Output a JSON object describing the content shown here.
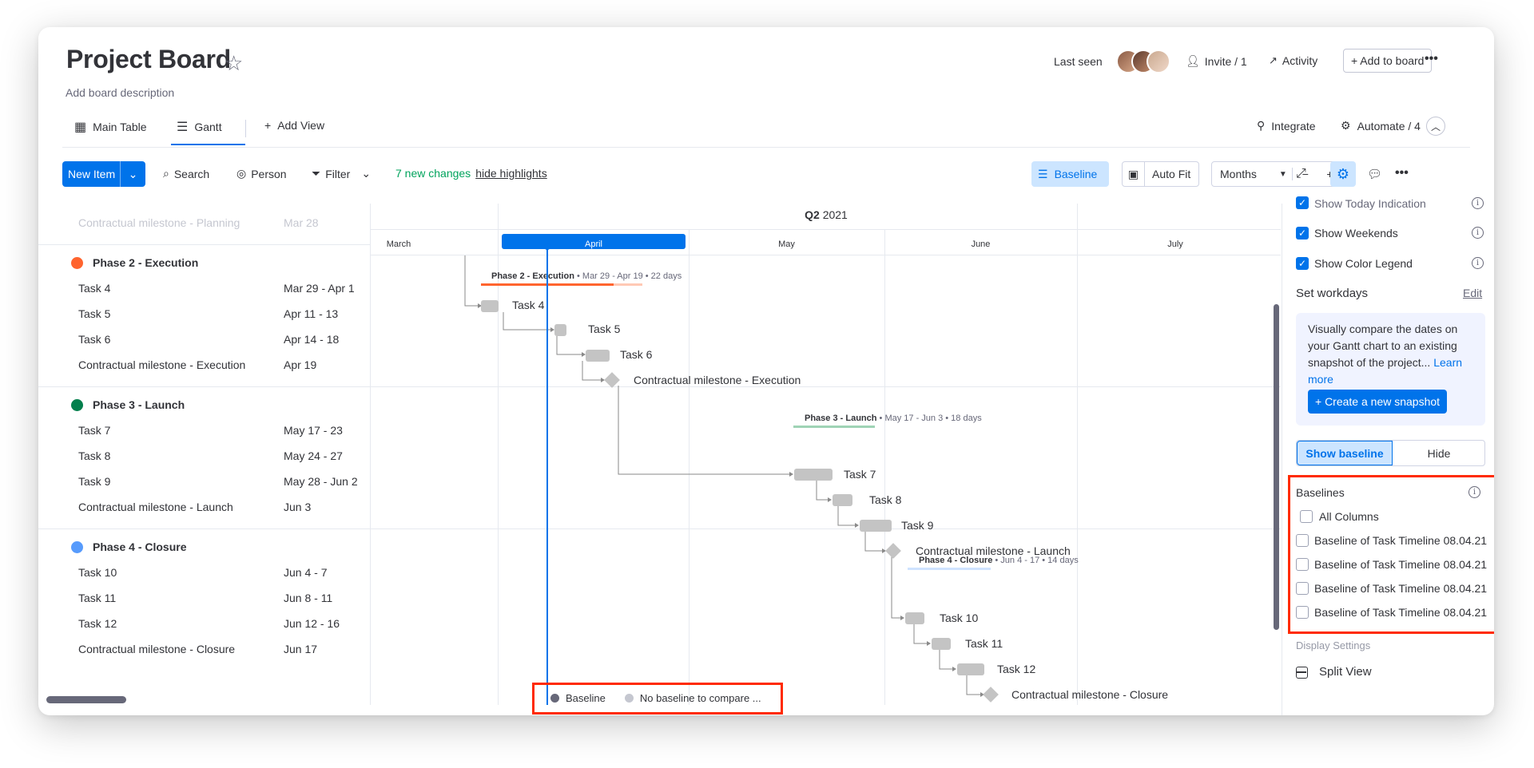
{
  "header": {
    "title": "Project Board",
    "description": "Add board description",
    "last_seen": "Last seen",
    "invite": "Invite / 1",
    "activity": "Activity",
    "add_to_board": "Add to board",
    "more": "•••"
  },
  "tabs": {
    "main_table": "Main Table",
    "gantt": "Gantt",
    "add_view": "Add View",
    "integrate": "Integrate",
    "automate": "Automate / 4"
  },
  "toolbar": {
    "new_item": "New Item",
    "search": "Search",
    "person": "Person",
    "filter": "Filter",
    "changes": "7 new changes",
    "hide_highlights": "hide highlights",
    "baseline": "Baseline",
    "auto_fit": "Auto Fit",
    "months": "Months",
    "minus": "−",
    "plus": "+"
  },
  "timeline": {
    "quarter": "Q2",
    "year": "2021",
    "months": [
      "March",
      "April",
      "May",
      "June",
      "July"
    ],
    "faded_task": "Contractual milestone - Planning",
    "faded_date": "Mar 28"
  },
  "groups": [
    {
      "name": "Phase 2 - Execution",
      "color": "#ff642e",
      "summary_name": "Phase 2 - Execution",
      "summary_rest": " • Mar 29 - Apr 19 • 22 days",
      "tasks": [
        {
          "name": "Task 4",
          "date": "Mar 29 - Apr 1"
        },
        {
          "name": "Task 5",
          "date": "Apr 11 - 13"
        },
        {
          "name": "Task 6",
          "date": "Apr 14 - 18"
        },
        {
          "name": "Contractual milestone - Execution",
          "date": "Apr 19"
        }
      ]
    },
    {
      "name": "Phase 3 - Launch",
      "color": "#037f4c",
      "summary_name": "Phase 3 - Launch",
      "summary_rest": " • May 17 - Jun 3 • 18 days",
      "tasks": [
        {
          "name": "Task 7",
          "date": "May 17 - 23"
        },
        {
          "name": "Task 8",
          "date": "May 24 - 27"
        },
        {
          "name": "Task 9",
          "date": "May 28 - Jun 2"
        },
        {
          "name": "Contractual milestone - Launch",
          "date": "Jun 3"
        }
      ]
    },
    {
      "name": "Phase 4 - Closure",
      "color": "#579bfc",
      "summary_name": "Phase 4 - Closure",
      "summary_rest": " • Jun 4 - 17 • 14 days",
      "tasks": [
        {
          "name": "Task 10",
          "date": "Jun 4 - 7"
        },
        {
          "name": "Task 11",
          "date": "Jun 8 - 11"
        },
        {
          "name": "Task 12",
          "date": "Jun 12 - 16"
        },
        {
          "name": "Contractual milestone - Closure",
          "date": "Jun 17"
        }
      ]
    }
  ],
  "settings": {
    "show_today": "Show Today Indication",
    "show_weekends": "Show Weekends",
    "show_color_legend": "Show Color Legend",
    "set_workdays": "Set workdays",
    "edit": "Edit",
    "info_text": "Visually compare the dates on your Gantt chart to an existing snapshot of the project...",
    "learn_more": "Learn more",
    "create_snapshot": "+ Create a new snapshot",
    "show_baseline": "Show baseline",
    "hide": "Hide",
    "baselines_title": "Baselines",
    "all_columns": "All Columns",
    "baseline_items": [
      "Baseline of Task Timeline 08.04.21",
      "Baseline of Task Timeline 08.04.21",
      "Baseline of Task Timeline 08.04.21",
      "Baseline of Task Timeline 08.04.21"
    ],
    "display_settings": "Display Settings",
    "split_view": "Split View"
  },
  "legend": {
    "baseline": "Baseline",
    "no_baseline": "No baseline to compare ..."
  },
  "colors": {
    "accent": "#0073ea",
    "highlight": "#ff2a00",
    "bar": "#c4c4c4"
  }
}
